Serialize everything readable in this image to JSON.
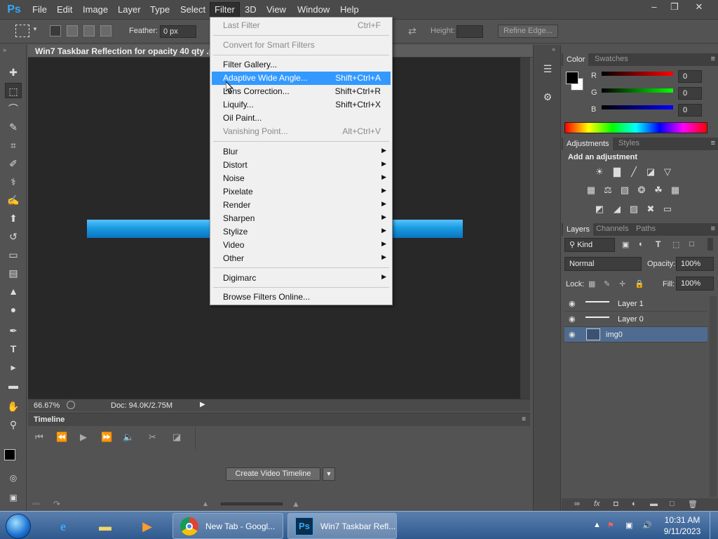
{
  "app": {
    "logo": "Ps",
    "menu": [
      "File",
      "Edit",
      "Image",
      "Layer",
      "Type",
      "Select",
      "Filter",
      "3D",
      "View",
      "Window",
      "Help"
    ],
    "active_menu": "Filter",
    "window_controls": [
      "minimize-icon",
      "restore-icon",
      "close-icon"
    ]
  },
  "options_bar": {
    "feather_label": "Feather:",
    "feather_value": "0 px",
    "height_label": "Height:",
    "refine_edge": "Refine Edge..."
  },
  "document": {
    "title": "Win7 Taskbar Reflection for opacity 40 qty .png",
    "zoom": "66.67%",
    "doc_size": "Doc: 94.0K/2.75M"
  },
  "timeline": {
    "title": "Timeline",
    "create_button": "Create Video Timeline"
  },
  "color_panel": {
    "tabs": [
      "Color",
      "Swatches"
    ],
    "channels": [
      {
        "label": "R",
        "value": "0",
        "gradient": "#ff0000"
      },
      {
        "label": "G",
        "value": "0",
        "gradient": "#00ff00"
      },
      {
        "label": "B",
        "value": "0",
        "gradient": "#0000ff"
      }
    ],
    "foreground": "#000000",
    "background": "#ffffff"
  },
  "adjustments_panel": {
    "tabs": [
      "Adjustments",
      "Styles"
    ],
    "title": "Add an adjustment"
  },
  "layers_panel": {
    "tabs": [
      "Layers",
      "Channels",
      "Paths"
    ],
    "kind": "Kind",
    "blend_mode": "Normal",
    "opacity_label": "Opacity:",
    "opacity_value": "100%",
    "lock_label": "Lock:",
    "fill_label": "Fill:",
    "fill_value": "100%",
    "layers": [
      {
        "name": "Layer 1",
        "selected": false
      },
      {
        "name": "Layer 0",
        "selected": false
      },
      {
        "name": "img0",
        "selected": true
      }
    ]
  },
  "filter_menu": {
    "items": [
      {
        "label": "Last Filter",
        "shortcut": "Ctrl+F",
        "disabled": true
      },
      {
        "label": "Convert for Smart Filters",
        "disabled": true
      },
      {
        "label": "Filter Gallery..."
      },
      {
        "label": "Adaptive Wide Angle...",
        "shortcut": "Shift+Ctrl+A",
        "highlighted": true
      },
      {
        "label": "Lens Correction...",
        "shortcut": "Shift+Ctrl+R"
      },
      {
        "label": "Liquify...",
        "shortcut": "Shift+Ctrl+X"
      },
      {
        "label": "Oil Paint..."
      },
      {
        "label": "Vanishing Point...",
        "shortcut": "Alt+Ctrl+V",
        "disabled": true
      },
      {
        "label": "Blur",
        "submenu": true
      },
      {
        "label": "Distort",
        "submenu": true
      },
      {
        "label": "Noise",
        "submenu": true
      },
      {
        "label": "Pixelate",
        "submenu": true
      },
      {
        "label": "Render",
        "submenu": true
      },
      {
        "label": "Sharpen",
        "submenu": true
      },
      {
        "label": "Stylize",
        "submenu": true
      },
      {
        "label": "Video",
        "submenu": true
      },
      {
        "label": "Other",
        "submenu": true
      },
      {
        "label": "Digimarc",
        "submenu": true
      },
      {
        "label": "Browse Filters Online..."
      }
    ]
  },
  "taskbar": {
    "tasks": [
      {
        "label": "New Tab - Googl...",
        "icon": "chrome-icon",
        "active": false
      },
      {
        "label": "Win7 Taskbar Refl...",
        "icon": "photoshop-icon",
        "active": true
      }
    ],
    "time": "10:31 AM",
    "date": "9/11/2023"
  },
  "colors": {
    "highlight": "#3399ff",
    "panel_bg": "#535353",
    "canvas_bg": "#282828",
    "selected_layer": "#4f6b8f"
  }
}
